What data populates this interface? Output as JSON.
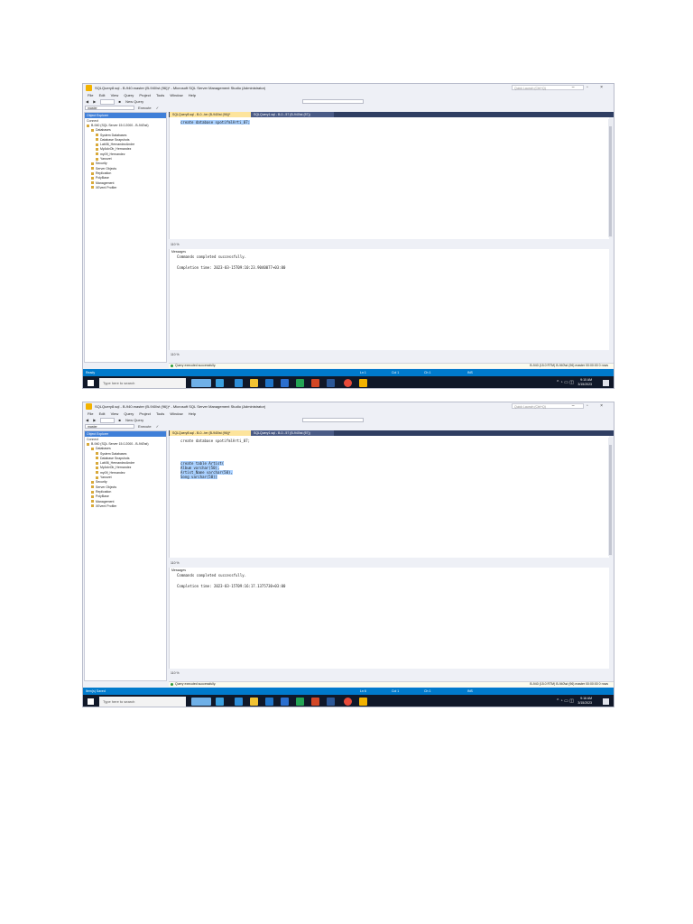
{
  "colors": {
    "titlebar_bg": "#eef0f6",
    "editor_tab_bar": "#2f3e62",
    "active_tab": "#fde49c",
    "selection": "#aad1ff",
    "statusbar": "#007acc",
    "taskbar": "#101829",
    "keyword": "#0000ff"
  },
  "screens": [
    {
      "window_title": "SQLQuery8.sql - B-940.master (B-940\\st (96))* - Microsoft SQL Server Management Studio (Administrator)",
      "quick_launch": "Quick Launch (Ctrl+Q)",
      "menu": [
        "File",
        "Edit",
        "View",
        "Query",
        "Project",
        "Tools",
        "Window",
        "Help"
      ],
      "toolbar": {
        "new_query": "New Query",
        "execute": "Execute",
        "database": "master"
      },
      "object_explorer": {
        "title": "Object Explorer",
        "connect": "Connect",
        "tree": [
          {
            "label": "B-940 (SQL Server 15.0.2000 - B-940\\st)",
            "level": 0
          },
          {
            "label": "Databases",
            "level": 1
          },
          {
            "label": "System Databases",
            "level": 2
          },
          {
            "label": "Database Snapshots",
            "level": 2
          },
          {
            "label": "Lab06_HernandezAndre",
            "level": 2
          },
          {
            "label": "MyAdvOb_Hernandez",
            "level": 2
          },
          {
            "label": "my09_Hernandez",
            "level": 2
          },
          {
            "label": "Yanovet",
            "level": 2
          },
          {
            "label": "Security",
            "level": 1
          },
          {
            "label": "Server Objects",
            "level": 1
          },
          {
            "label": "Replication",
            "level": 1
          },
          {
            "label": "PolyBase",
            "level": 1
          },
          {
            "label": "Management",
            "level": 1
          },
          {
            "label": "XEvent Profiler",
            "level": 1
          }
        ]
      },
      "tabs": [
        "SQLQuery8.sql - B-0...ter (B-940\\st (96))*",
        "SQLQuery1.sql - B-0...57 (B-940\\st (57))"
      ],
      "code": [
        "create database spotifmlArti_07;"
      ],
      "zoom": "110 %",
      "messages_tab": "Messages",
      "messages": [
        "Commands completed successfully.",
        "",
        "Completion time: 2023-03-15T09:10:23.9040077+03:00"
      ],
      "results_zoom": "110 %",
      "query_status": "Query executed successfully.",
      "query_status_right": "B-940 (15.0 RTM)   B-940\\st (96)   master   00:00:00   0 rows",
      "statusbar": {
        "left": "Ready",
        "ln": "Ln 1",
        "col": "Col 1",
        "ch": "Ch 1",
        "mode": "INS"
      },
      "taskbar": {
        "search": "Type here to search",
        "time": "9:10 AM",
        "date": "3/15/2023"
      }
    },
    {
      "window_title": "SQLQuery8.sql - B-940.master (B-940\\st (96))* - Microsoft SQL Server Management Studio (Administrator)",
      "quick_launch": "Quick Launch (Ctrl+Q)",
      "menu": [
        "File",
        "Edit",
        "View",
        "Query",
        "Project",
        "Tools",
        "Window",
        "Help"
      ],
      "toolbar": {
        "new_query": "New Query",
        "execute": "Execute",
        "database": "master"
      },
      "object_explorer": {
        "title": "Object Explorer",
        "connect": "Connect",
        "tree": [
          {
            "label": "B-940 (SQL Server 15.0.2000 - B-940\\st)",
            "level": 0
          },
          {
            "label": "Databases",
            "level": 1
          },
          {
            "label": "System Databases",
            "level": 2
          },
          {
            "label": "Database Snapshots",
            "level": 2
          },
          {
            "label": "Lab06_HernandezAndre",
            "level": 2
          },
          {
            "label": "MyAdvOb_Hernandez",
            "level": 2
          },
          {
            "label": "my09_Hernandez",
            "level": 2
          },
          {
            "label": "Yanovet",
            "level": 2
          },
          {
            "label": "Security",
            "level": 1
          },
          {
            "label": "Server Objects",
            "level": 1
          },
          {
            "label": "Replication",
            "level": 1
          },
          {
            "label": "PolyBase",
            "level": 1
          },
          {
            "label": "Management",
            "level": 1
          },
          {
            "label": "XEvent Profiler",
            "level": 1
          }
        ]
      },
      "tabs": [
        "SQLQuery8.sql - B-0...ter (B-940\\st (96))*",
        "SQLQuery1.sql - B-0...57 (B-940\\st (57))"
      ],
      "code": [
        "create database spotifmlArti_07;",
        "",
        "",
        "",
        "",
        "create table Artist(",
        "Album varchar(50),",
        "Artist_Name varchar(50),",
        "Song varchar(50))"
      ],
      "zoom": "110 %",
      "messages_tab": "Messages",
      "messages": [
        "Commands completed successfully.",
        "",
        "Completion time: 2023-03-15T09:16:17.1375730+03:00"
      ],
      "results_zoom": "110 %",
      "query_status": "Query executed successfully.",
      "query_status_right": "B-940 (15.0 RTM)   B-940\\st (96)   master   00:00:00   0 rows",
      "statusbar": {
        "left": "Item(s) Saved",
        "ln": "Ln 6",
        "col": "Col 1",
        "ch": "Ch 1",
        "mode": "INS"
      },
      "taskbar": {
        "search": "Type here to search",
        "time": "9:16 AM",
        "date": "3/15/2023"
      }
    }
  ]
}
